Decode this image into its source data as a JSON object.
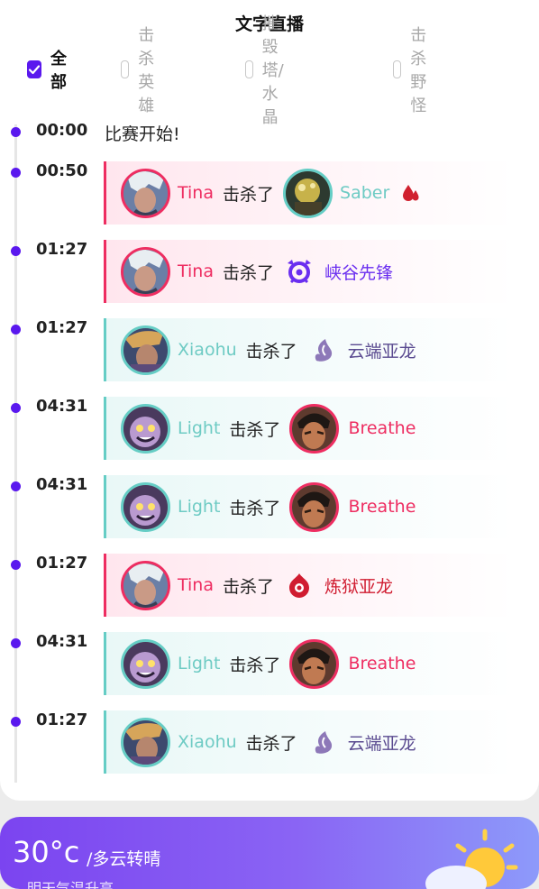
{
  "header": {
    "title": "文字直播"
  },
  "filters": [
    {
      "label": "全部",
      "checked": true
    },
    {
      "label": "击杀英雄",
      "checked": false
    },
    {
      "label": "摧毁塔/水晶",
      "checked": false
    },
    {
      "label": "击杀野怪",
      "checked": false
    }
  ],
  "events": [
    {
      "time": "00:00",
      "text": "比赛开始!"
    },
    {
      "time": "00:50",
      "actor": "Tina",
      "verb": "击杀了",
      "target": "Saber",
      "badge": "first-blood-icon"
    },
    {
      "time": "01:27",
      "actor": "Tina",
      "verb": "击杀了",
      "target": "峡谷先锋"
    },
    {
      "time": "01:27",
      "actor": "Xiaohu",
      "verb": "击杀了",
      "target": "云端亚龙"
    },
    {
      "time": "04:31",
      "actor": "Light",
      "verb": "击杀了",
      "target": "Breathe"
    },
    {
      "time": "04:31",
      "actor": "Light",
      "verb": "击杀了",
      "target": "Breathe"
    },
    {
      "time": "01:27",
      "actor": "Tina",
      "verb": "击杀了",
      "target": "炼狱亚龙"
    },
    {
      "time": "04:31",
      "actor": "Light",
      "verb": "击杀了",
      "target": "Breathe"
    },
    {
      "time": "01:27",
      "actor": "Xiaohu",
      "verb": "击杀了",
      "target": "云端亚龙"
    }
  ],
  "weather": {
    "temp": "30°c",
    "desc": "/多云转晴",
    "sub": "…明天气温升高"
  },
  "colors": {
    "accent": "#5a18ee",
    "red_team": "#ee2d61",
    "blue_team": "#65cdc5"
  }
}
